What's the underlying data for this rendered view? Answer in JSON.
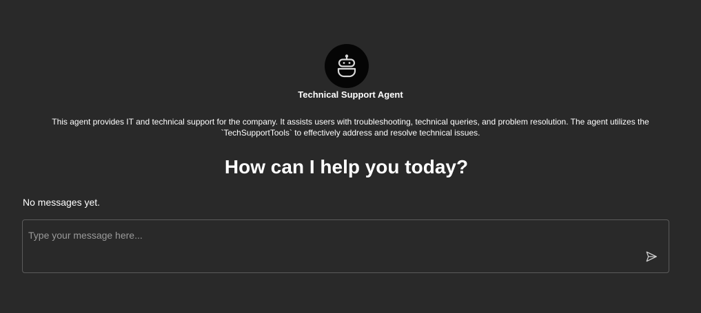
{
  "agent": {
    "avatar_icon": "robot-icon",
    "name": "Technical Support Agent",
    "description": "This agent provides IT and technical support for the company. It assists users with troubleshooting, technical queries, and problem resolution. The agent utilizes the `TechSupportTools` to effectively address and resolve technical issues."
  },
  "main": {
    "headline": "How can I help you today?",
    "empty_state": "No messages yet."
  },
  "composer": {
    "placeholder": "Type your message here...",
    "value": "",
    "send_icon": "send-icon"
  },
  "colors": {
    "background": "#292929",
    "avatar_bg": "#050505",
    "text": "#ffffff",
    "input_border": "#5c5c5c",
    "placeholder": "#9a9a9a"
  }
}
